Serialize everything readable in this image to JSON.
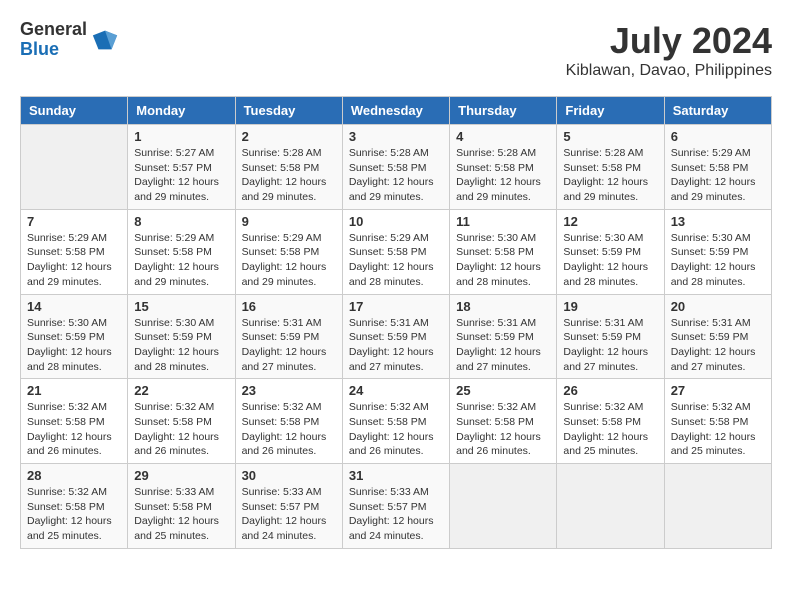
{
  "logo": {
    "general": "General",
    "blue": "Blue"
  },
  "title": {
    "month_year": "July 2024",
    "location": "Kiblawan, Davao, Philippines"
  },
  "headers": [
    "Sunday",
    "Monday",
    "Tuesday",
    "Wednesday",
    "Thursday",
    "Friday",
    "Saturday"
  ],
  "weeks": [
    [
      {
        "day": "",
        "content": ""
      },
      {
        "day": "1",
        "content": "Sunrise: 5:27 AM\nSunset: 5:57 PM\nDaylight: 12 hours\nand 29 minutes."
      },
      {
        "day": "2",
        "content": "Sunrise: 5:28 AM\nSunset: 5:58 PM\nDaylight: 12 hours\nand 29 minutes."
      },
      {
        "day": "3",
        "content": "Sunrise: 5:28 AM\nSunset: 5:58 PM\nDaylight: 12 hours\nand 29 minutes."
      },
      {
        "day": "4",
        "content": "Sunrise: 5:28 AM\nSunset: 5:58 PM\nDaylight: 12 hours\nand 29 minutes."
      },
      {
        "day": "5",
        "content": "Sunrise: 5:28 AM\nSunset: 5:58 PM\nDaylight: 12 hours\nand 29 minutes."
      },
      {
        "day": "6",
        "content": "Sunrise: 5:29 AM\nSunset: 5:58 PM\nDaylight: 12 hours\nand 29 minutes."
      }
    ],
    [
      {
        "day": "7",
        "content": "Sunrise: 5:29 AM\nSunset: 5:58 PM\nDaylight: 12 hours\nand 29 minutes."
      },
      {
        "day": "8",
        "content": "Sunrise: 5:29 AM\nSunset: 5:58 PM\nDaylight: 12 hours\nand 29 minutes."
      },
      {
        "day": "9",
        "content": "Sunrise: 5:29 AM\nSunset: 5:58 PM\nDaylight: 12 hours\nand 29 minutes."
      },
      {
        "day": "10",
        "content": "Sunrise: 5:29 AM\nSunset: 5:58 PM\nDaylight: 12 hours\nand 28 minutes."
      },
      {
        "day": "11",
        "content": "Sunrise: 5:30 AM\nSunset: 5:58 PM\nDaylight: 12 hours\nand 28 minutes."
      },
      {
        "day": "12",
        "content": "Sunrise: 5:30 AM\nSunset: 5:59 PM\nDaylight: 12 hours\nand 28 minutes."
      },
      {
        "day": "13",
        "content": "Sunrise: 5:30 AM\nSunset: 5:59 PM\nDaylight: 12 hours\nand 28 minutes."
      }
    ],
    [
      {
        "day": "14",
        "content": "Sunrise: 5:30 AM\nSunset: 5:59 PM\nDaylight: 12 hours\nand 28 minutes."
      },
      {
        "day": "15",
        "content": "Sunrise: 5:30 AM\nSunset: 5:59 PM\nDaylight: 12 hours\nand 28 minutes."
      },
      {
        "day": "16",
        "content": "Sunrise: 5:31 AM\nSunset: 5:59 PM\nDaylight: 12 hours\nand 27 minutes."
      },
      {
        "day": "17",
        "content": "Sunrise: 5:31 AM\nSunset: 5:59 PM\nDaylight: 12 hours\nand 27 minutes."
      },
      {
        "day": "18",
        "content": "Sunrise: 5:31 AM\nSunset: 5:59 PM\nDaylight: 12 hours\nand 27 minutes."
      },
      {
        "day": "19",
        "content": "Sunrise: 5:31 AM\nSunset: 5:59 PM\nDaylight: 12 hours\nand 27 minutes."
      },
      {
        "day": "20",
        "content": "Sunrise: 5:31 AM\nSunset: 5:59 PM\nDaylight: 12 hours\nand 27 minutes."
      }
    ],
    [
      {
        "day": "21",
        "content": "Sunrise: 5:32 AM\nSunset: 5:58 PM\nDaylight: 12 hours\nand 26 minutes."
      },
      {
        "day": "22",
        "content": "Sunrise: 5:32 AM\nSunset: 5:58 PM\nDaylight: 12 hours\nand 26 minutes."
      },
      {
        "day": "23",
        "content": "Sunrise: 5:32 AM\nSunset: 5:58 PM\nDaylight: 12 hours\nand 26 minutes."
      },
      {
        "day": "24",
        "content": "Sunrise: 5:32 AM\nSunset: 5:58 PM\nDaylight: 12 hours\nand 26 minutes."
      },
      {
        "day": "25",
        "content": "Sunrise: 5:32 AM\nSunset: 5:58 PM\nDaylight: 12 hours\nand 26 minutes."
      },
      {
        "day": "26",
        "content": "Sunrise: 5:32 AM\nSunset: 5:58 PM\nDaylight: 12 hours\nand 25 minutes."
      },
      {
        "day": "27",
        "content": "Sunrise: 5:32 AM\nSunset: 5:58 PM\nDaylight: 12 hours\nand 25 minutes."
      }
    ],
    [
      {
        "day": "28",
        "content": "Sunrise: 5:32 AM\nSunset: 5:58 PM\nDaylight: 12 hours\nand 25 minutes."
      },
      {
        "day": "29",
        "content": "Sunrise: 5:33 AM\nSunset: 5:58 PM\nDaylight: 12 hours\nand 25 minutes."
      },
      {
        "day": "30",
        "content": "Sunrise: 5:33 AM\nSunset: 5:57 PM\nDaylight: 12 hours\nand 24 minutes."
      },
      {
        "day": "31",
        "content": "Sunrise: 5:33 AM\nSunset: 5:57 PM\nDaylight: 12 hours\nand 24 minutes."
      },
      {
        "day": "",
        "content": ""
      },
      {
        "day": "",
        "content": ""
      },
      {
        "day": "",
        "content": ""
      }
    ]
  ]
}
